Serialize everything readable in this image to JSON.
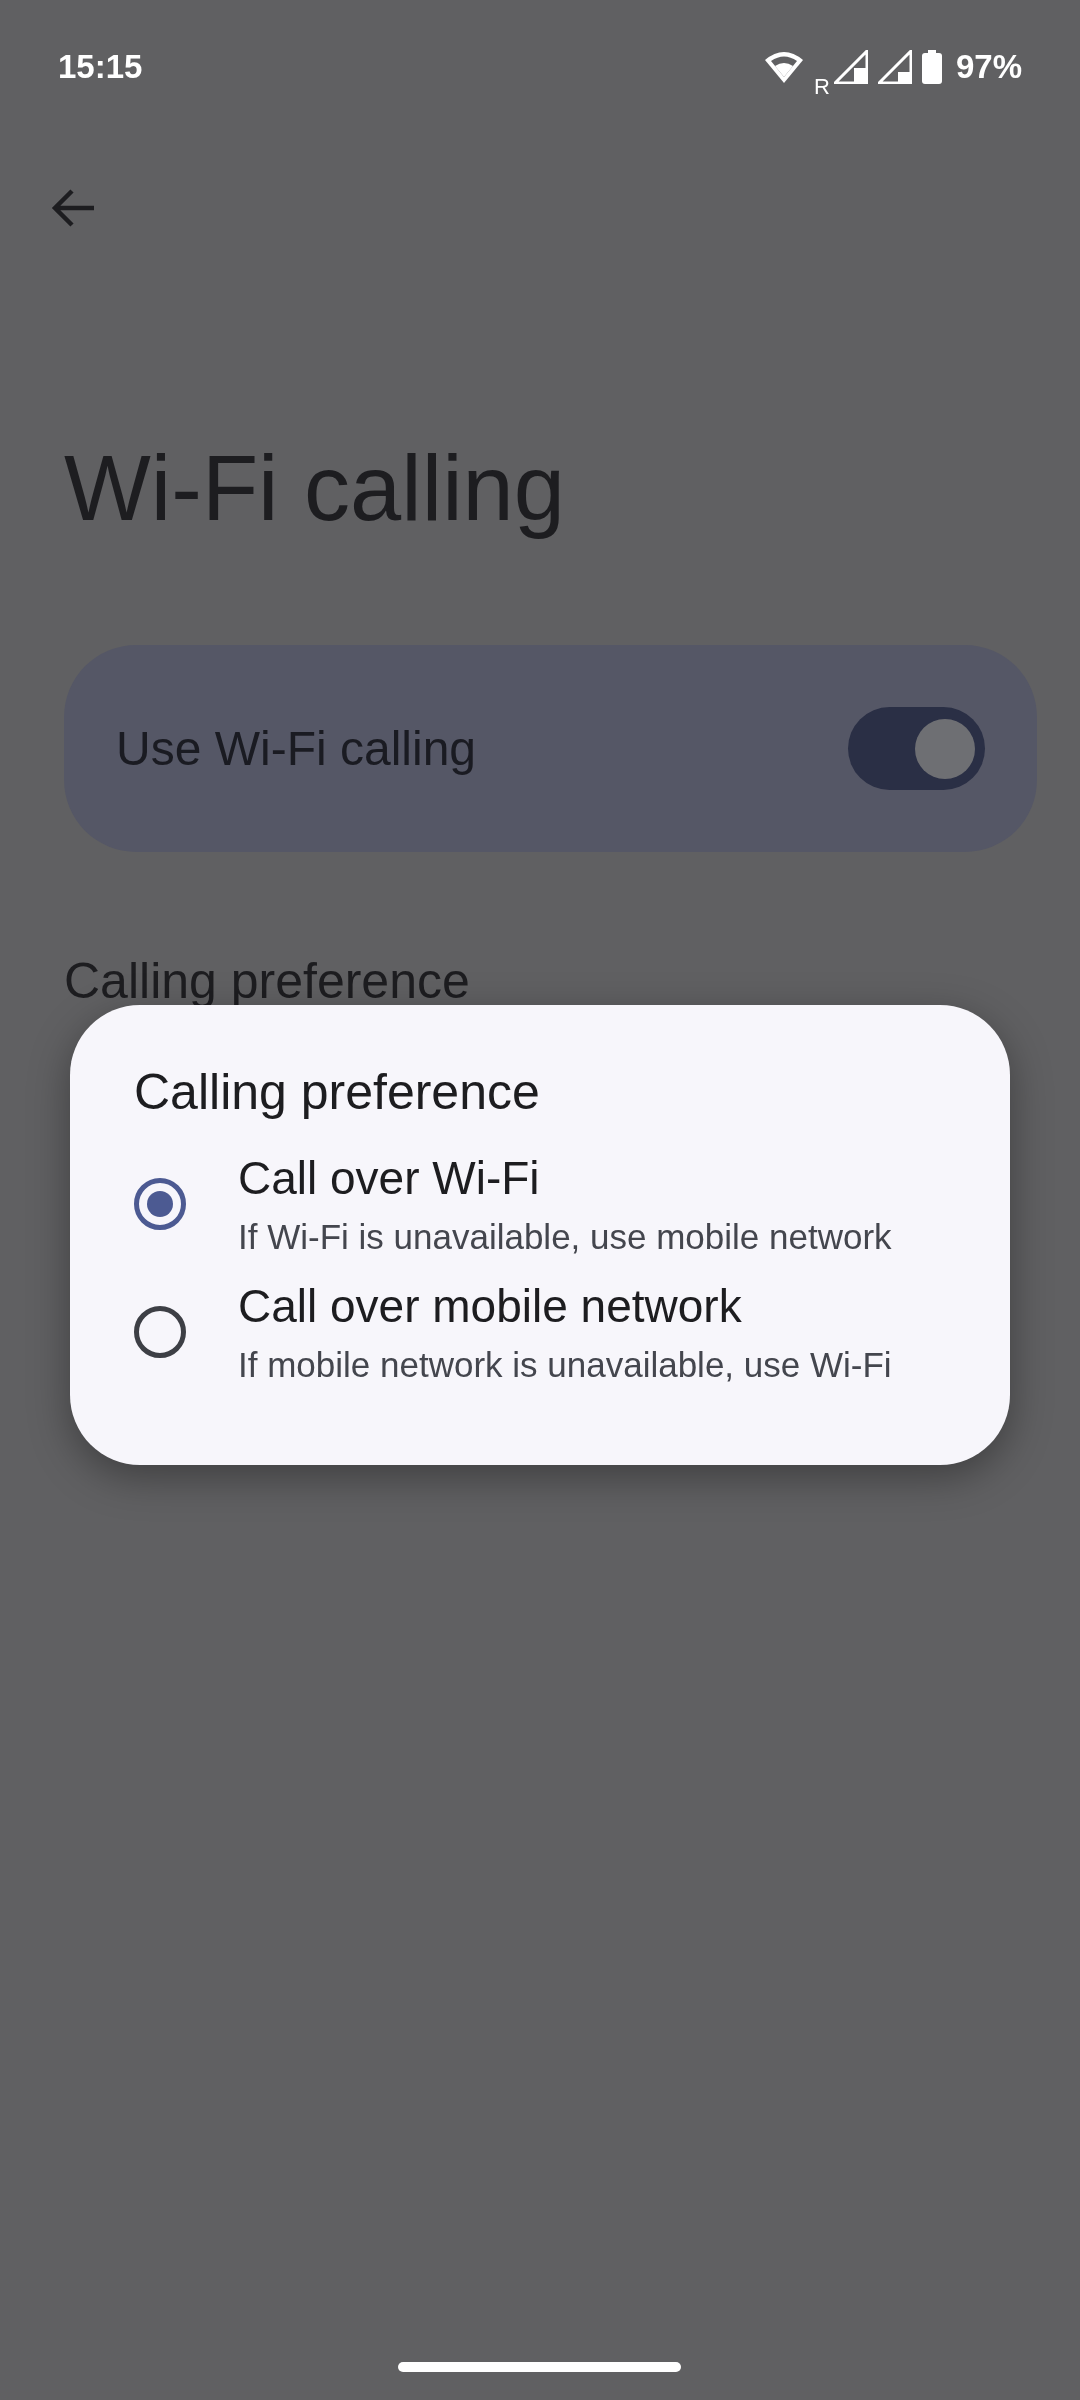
{
  "status_bar": {
    "time": "15:15",
    "roaming_label": "R",
    "battery": "97%"
  },
  "title": "Wi-Fi calling",
  "main_switch": {
    "label": "Use Wi-Fi calling",
    "on": true
  },
  "preference_item": {
    "title": "Calling preference"
  },
  "dialog": {
    "title": "Calling preference",
    "options": [
      {
        "title": "Call over Wi-Fi",
        "subtitle": "If Wi-Fi is unavailable, use mobile network",
        "selected": true
      },
      {
        "title": "Call over mobile network",
        "subtitle": "If mobile network is unavailable, use Wi-Fi",
        "selected": false
      }
    ]
  }
}
